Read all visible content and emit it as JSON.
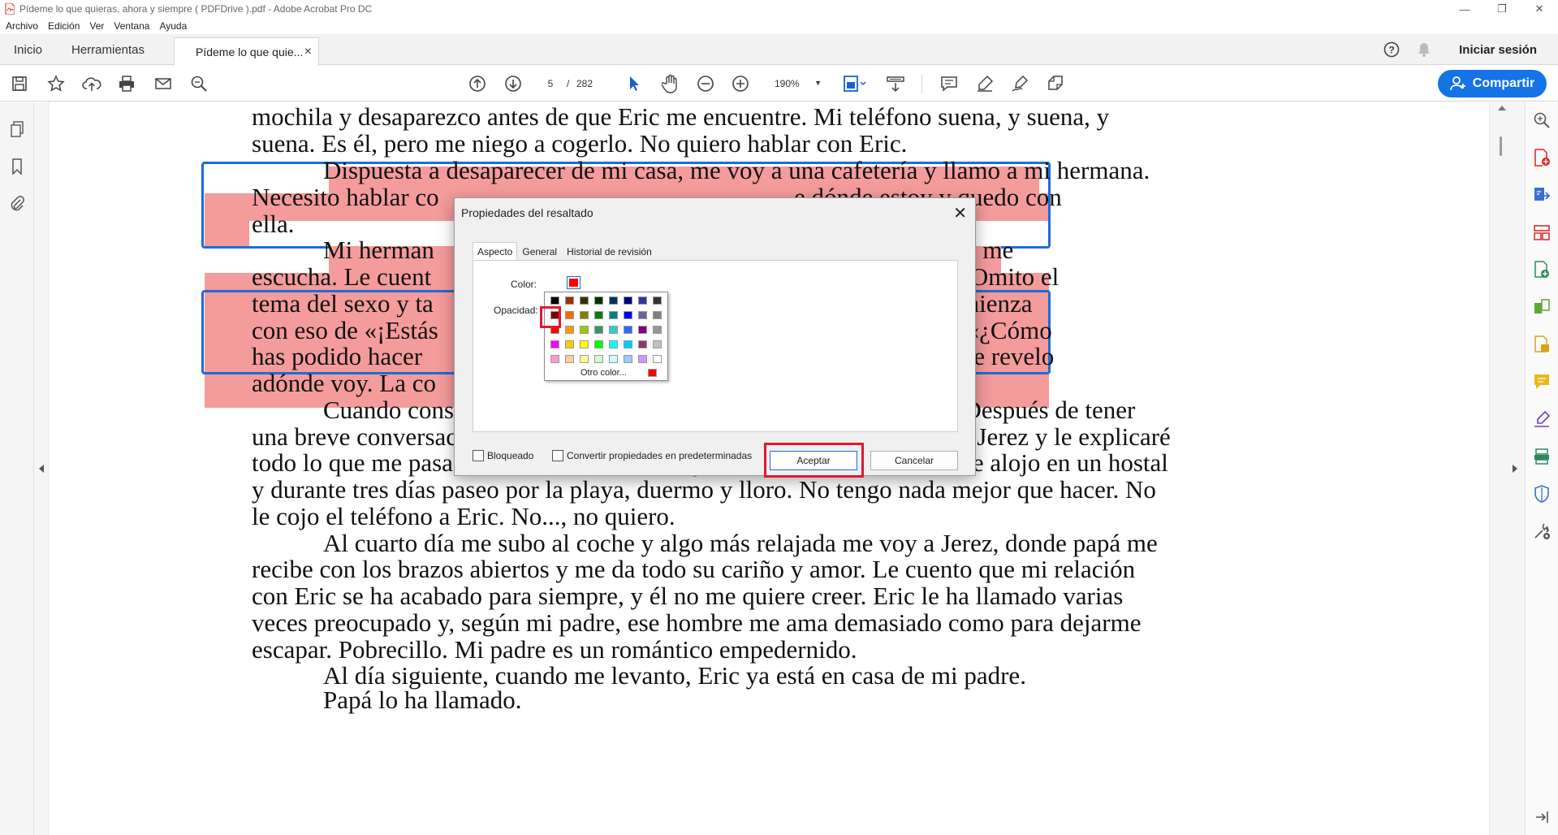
{
  "window": {
    "title": "Pídeme lo que quieras, ahora y siempre ( PDFDrive ).pdf - Adobe Acrobat Pro DC"
  },
  "menu": [
    "Archivo",
    "Edición",
    "Ver",
    "Ventana",
    "Ayuda"
  ],
  "tabs": {
    "home": "Inicio",
    "tools": "Herramientas",
    "document": "Pídeme lo que quie...",
    "close": "×",
    "signin": "Iniciar sesión"
  },
  "toolbar": {
    "page_current": "5",
    "page_sep": "/",
    "page_total": "282",
    "zoom": "190%",
    "share": "Compartir"
  },
  "document": {
    "lines": [
      "mochila y desaparezco antes de que Eric me encuentre. Mi teléfono suena, y suena, y",
      "suena. Es él, pero me niego a cogerlo. No quiero hablar con Eric.",
      "Dispuesta a desaparecer de mi casa, me voy a una cafetería y llamo a mi hermana.",
      "Necesito hablar co",
      "e dónde estoy y quedo con",
      "ella.",
      "Mi herman",
      "sabe que necesito, me",
      "escucha. Le cuent",
      "aría sin palabras. Omito el",
      "tema del sexo y ta",
      "no le cuadran comienza",
      "con eso de «¡Estás",
      "buen partido!» o «¿Cómo",
      "has podido hacer",
      "su insistencia no le revelo",
      "adónde voy. La co",
      "Cuando consigo despegarme de mi hermana, llamo a mi padre. Después de tener",
      "una breve conversación con él y hacerle entender que en unos días iré a Jerez y le explicaré",
      "todo lo que me pasa, me monto en el coche y me voy a Valencia. Allí me alojo en un hostal",
      "y durante tres días paseo por la playa, duermo y lloro. No tengo nada mejor que hacer. No",
      "le cojo el teléfono a Eric. No..., no quiero.",
      "Al cuarto día me subo al coche y algo más relajada me voy a Jerez, donde papá me",
      "recibe con los brazos abiertos y me da todo su cariño y amor. Le cuento que mi relación",
      "con Eric se ha acabado para siempre, y él no me quiere creer. Eric le ha llamado varias",
      "veces preocupado y, según mi padre, ese hombre me ama demasiado como para dejarme",
      "escapar. Pobrecillo. Mi padre es un romántico empedernido.",
      "Al día siguiente, cuando me levanto, Eric ya está en casa de mi padre.",
      "Papá lo ha llamado."
    ],
    "highlight_color": "#f49b9b"
  },
  "dialog": {
    "title": "Propiedades del resaltado",
    "close": "✕",
    "tabs": [
      "Aspecto",
      "General",
      "Historial de revisión"
    ],
    "color_label": "Color:",
    "opacity_label": "Opacidad:",
    "other_color": "Otro color...",
    "selected_color": "#ff0000",
    "palette": [
      [
        "#000000",
        "#993300",
        "#333300",
        "#003300",
        "#003366",
        "#000080",
        "#333399",
        "#333333"
      ],
      [
        "#800000",
        "#ff6600",
        "#808000",
        "#008000",
        "#008080",
        "#0000ff",
        "#666699",
        "#808080"
      ],
      [
        "#ff0000",
        "#ff9900",
        "#99cc00",
        "#339966",
        "#33cccc",
        "#3366ff",
        "#800080",
        "#969696"
      ],
      [
        "#ff00ff",
        "#ffcc00",
        "#ffff00",
        "#00ff00",
        "#00ffff",
        "#00ccff",
        "#993366",
        "#c0c0c0"
      ],
      [
        "#ff99cc",
        "#ffcc99",
        "#ffff99",
        "#ccffcc",
        "#ccffff",
        "#99ccff",
        "#cc99ff",
        "#ffffff"
      ]
    ],
    "locked_label": "Bloqueado",
    "default_label": "Convertir propiedades en predeterminadas",
    "ok": "Aceptar",
    "cancel": "Cancelar"
  }
}
